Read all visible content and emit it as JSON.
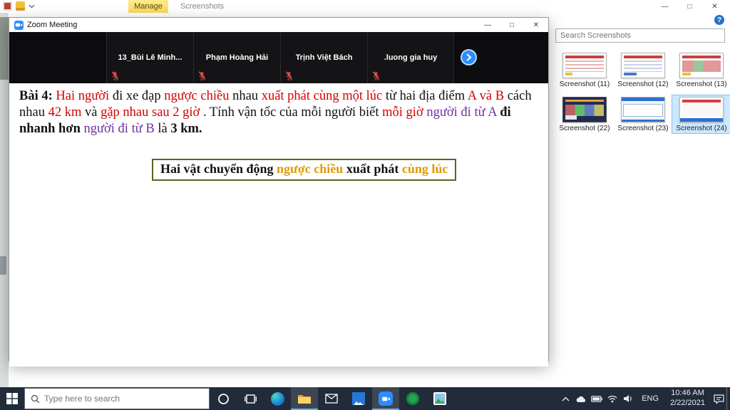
{
  "window_controls": {
    "minimize": "—",
    "maximize": "□",
    "close": "✕"
  },
  "explorer": {
    "context_tab": "Manage",
    "window_title": "Screenshots",
    "help_label": "?",
    "search_placeholder": "Search Screenshots",
    "files": [
      {
        "label": "Screenshot (11)",
        "cls": "t11"
      },
      {
        "label": "Screenshot (12)",
        "cls": "t12"
      },
      {
        "label": "Screenshot (13)",
        "cls": "t13"
      },
      {
        "label": "Screenshot (22)",
        "cls": "t22"
      },
      {
        "label": "Screenshot (23)",
        "cls": "t23"
      },
      {
        "label": "Screenshot (24)",
        "cls": "t24 selected"
      }
    ]
  },
  "zoom": {
    "window_title": "Zoom Meeting",
    "participants": [
      {
        "name": "13_Bùi Lê Minh..."
      },
      {
        "name": "Phạm Hoàng Hải"
      },
      {
        "name": "Trịnh Việt Bách"
      },
      {
        "name": ".luong gia huy"
      }
    ],
    "problem_segments": [
      {
        "text": "Bài 4: ",
        "cls": "b"
      },
      {
        "text": "Hai người ",
        "cls": "red"
      },
      {
        "text": "đi xe đạp ",
        "cls": ""
      },
      {
        "text": "ngược chiều ",
        "cls": "red"
      },
      {
        "text": "nhau ",
        "cls": ""
      },
      {
        "text": "xuất phát cùng một lúc ",
        "cls": "red"
      },
      {
        "text": "từ hai địa điểm ",
        "cls": ""
      },
      {
        "text": "A và B ",
        "cls": "red"
      },
      {
        "text": "cách nhau ",
        "cls": ""
      },
      {
        "text": "42 km ",
        "cls": "red"
      },
      {
        "text": "và ",
        "cls": ""
      },
      {
        "text": "gặp nhau sau 2 giờ",
        "cls": "red"
      },
      {
        "text": ". Tính vận tốc của mỗi người biết ",
        "cls": ""
      },
      {
        "text": "mỗi giờ ",
        "cls": "red"
      },
      {
        "text": "người đi từ A ",
        "cls": "purple"
      },
      {
        "text": "đi nhanh hơn ",
        "cls": "b"
      },
      {
        "text": "người đi từ B ",
        "cls": "purple"
      },
      {
        "text": "là ",
        "cls": ""
      },
      {
        "text": "3 km.",
        "cls": "b"
      }
    ],
    "box_segments": [
      {
        "text": "Hai vật chuyển động ",
        "cls": ""
      },
      {
        "text": "ngược chiều ",
        "cls": "orange"
      },
      {
        "text": "xuất phát ",
        "cls": ""
      },
      {
        "text": "cùng lúc",
        "cls": "orange"
      }
    ]
  },
  "taskbar": {
    "search_placeholder": "Type here to search",
    "language": "ENG",
    "time": "10:46 AM",
    "date": "2/22/2021"
  },
  "colors": {
    "accent_red": "#d60000",
    "accent_purple": "#7030a0",
    "accent_orange": "#e09a00",
    "box_border": "#51681f",
    "zoom_blue": "#2d8cff"
  }
}
